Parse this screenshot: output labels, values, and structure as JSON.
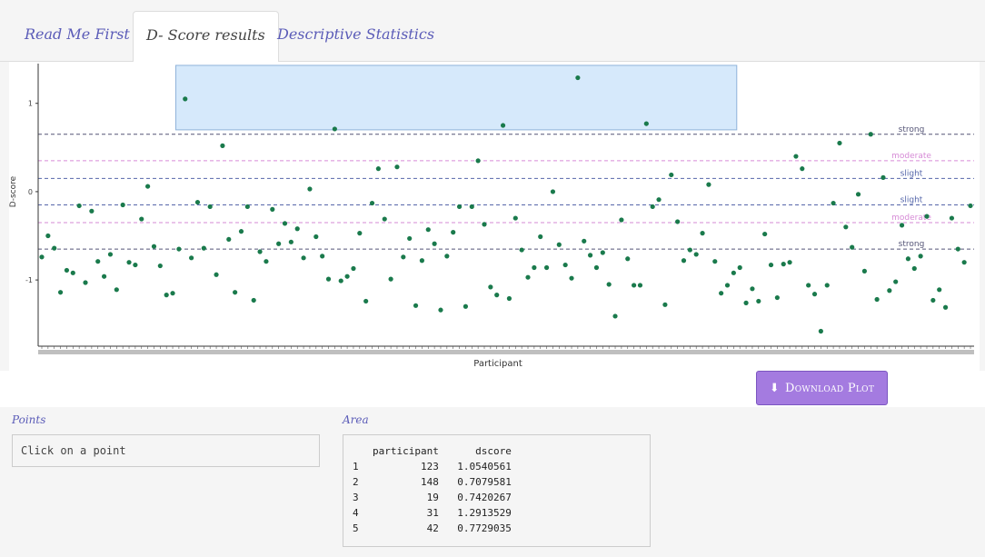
{
  "tabs": [
    {
      "label": "Read Me First",
      "active": false
    },
    {
      "label": "D- Score results",
      "active": true
    },
    {
      "label": "Descriptive Statistics",
      "active": false
    }
  ],
  "plot": {
    "xlabel": "Participant",
    "ylabel": "D-score",
    "point_color": "#1a7a4c",
    "selection_color": "#d6e9fb",
    "reference_lines": [
      {
        "label": "strong",
        "value": 0.65,
        "color": "#555577"
      },
      {
        "label": "moderate",
        "value": 0.35,
        "color": "#d68ad6"
      },
      {
        "label": "slight",
        "value": 0.15,
        "color": "#5566aa"
      },
      {
        "label": "slight",
        "value": -0.15,
        "color": "#5566aa"
      },
      {
        "label": "moderate",
        "value": -0.35,
        "color": "#d68ad6"
      },
      {
        "label": "strong",
        "value": -0.65,
        "color": "#555577"
      }
    ]
  },
  "chart_data": {
    "type": "scatter",
    "xlabel": "Participant",
    "ylabel": "D-score",
    "yticks": [
      "1",
      "0",
      "-1"
    ],
    "ylim": [
      -1.75,
      1.45
    ],
    "grid": false,
    "y": [
      -0.74,
      -0.5,
      -0.64,
      -1.14,
      -0.89,
      -0.92,
      -0.16,
      -1.03,
      -0.22,
      -0.79,
      -0.96,
      -0.71,
      -1.11,
      -0.15,
      -0.8,
      -0.83,
      -0.31,
      0.06,
      -0.62,
      -0.84,
      -1.17,
      -1.15,
      -0.65,
      1.05,
      -0.75,
      -0.12,
      -0.64,
      -0.17,
      -0.94,
      0.52,
      -0.54,
      -1.14,
      -0.45,
      -0.17,
      -1.23,
      -0.68,
      -0.79,
      -0.2,
      -0.59,
      -0.36,
      -0.57,
      -0.42,
      -0.75,
      0.03,
      -0.51,
      -0.73,
      -0.99,
      0.71,
      -1.01,
      -0.96,
      -0.87,
      -0.47,
      -1.24,
      -0.13,
      0.26,
      -0.31,
      -0.99,
      0.28,
      -0.74,
      -0.53,
      -1.29,
      -0.78,
      -0.43,
      -0.59,
      -1.34,
      -0.73,
      -0.46,
      -0.17,
      -1.3,
      -0.17,
      0.35,
      -0.37,
      -1.08,
      -1.17,
      0.75,
      -1.21,
      -0.3,
      -0.66,
      -0.97,
      -0.86,
      -0.51,
      -0.86,
      0.0,
      -0.6,
      -0.83,
      -0.98,
      1.29,
      -0.56,
      -0.72,
      -0.86,
      -0.69,
      -1.05,
      -1.41,
      -0.32,
      -0.76,
      -1.06,
      -1.06,
      0.77,
      -0.17,
      -0.09,
      -1.28,
      0.19,
      -0.34,
      -0.78,
      -0.66,
      -0.71,
      -0.47,
      0.08,
      -0.79,
      -1.15,
      -1.06,
      -0.92,
      -0.86,
      -1.26,
      -1.1,
      -1.24,
      -0.48,
      -0.83,
      -1.2,
      -0.82,
      -0.8,
      0.4,
      0.26,
      -1.06,
      -1.16,
      -1.58,
      -1.06,
      -0.13,
      0.55,
      -0.4,
      -0.63,
      -0.03,
      -0.9,
      0.65,
      -1.22,
      0.16,
      -1.12,
      -1.02,
      -0.38,
      -0.76,
      -0.87,
      -0.73,
      -0.28,
      -1.23,
      -1.11,
      -1.31,
      -0.3,
      -0.65,
      -0.8,
      -0.16
    ],
    "selected_area": {
      "participant": [
        123,
        148,
        19,
        31,
        42
      ],
      "dscore": [
        1.0540561,
        0.7079581,
        0.7420267,
        1.2913529,
        0.7729035
      ]
    }
  },
  "download_button": {
    "label": "Download Plot",
    "icon": "download-icon"
  },
  "points": {
    "label": "Points",
    "placeholder": "Click on a point"
  },
  "area": {
    "label": "Area",
    "columns": [
      "participant",
      "dscore"
    ],
    "rows": [
      {
        "idx": "1",
        "participant": "123",
        "dscore": "1.0540561"
      },
      {
        "idx": "2",
        "participant": "148",
        "dscore": "0.7079581"
      },
      {
        "idx": "3",
        "participant": "19",
        "dscore": "0.7420267"
      },
      {
        "idx": "4",
        "participant": "31",
        "dscore": "1.2913529"
      },
      {
        "idx": "5",
        "participant": "42",
        "dscore": "0.7729035"
      }
    ]
  }
}
